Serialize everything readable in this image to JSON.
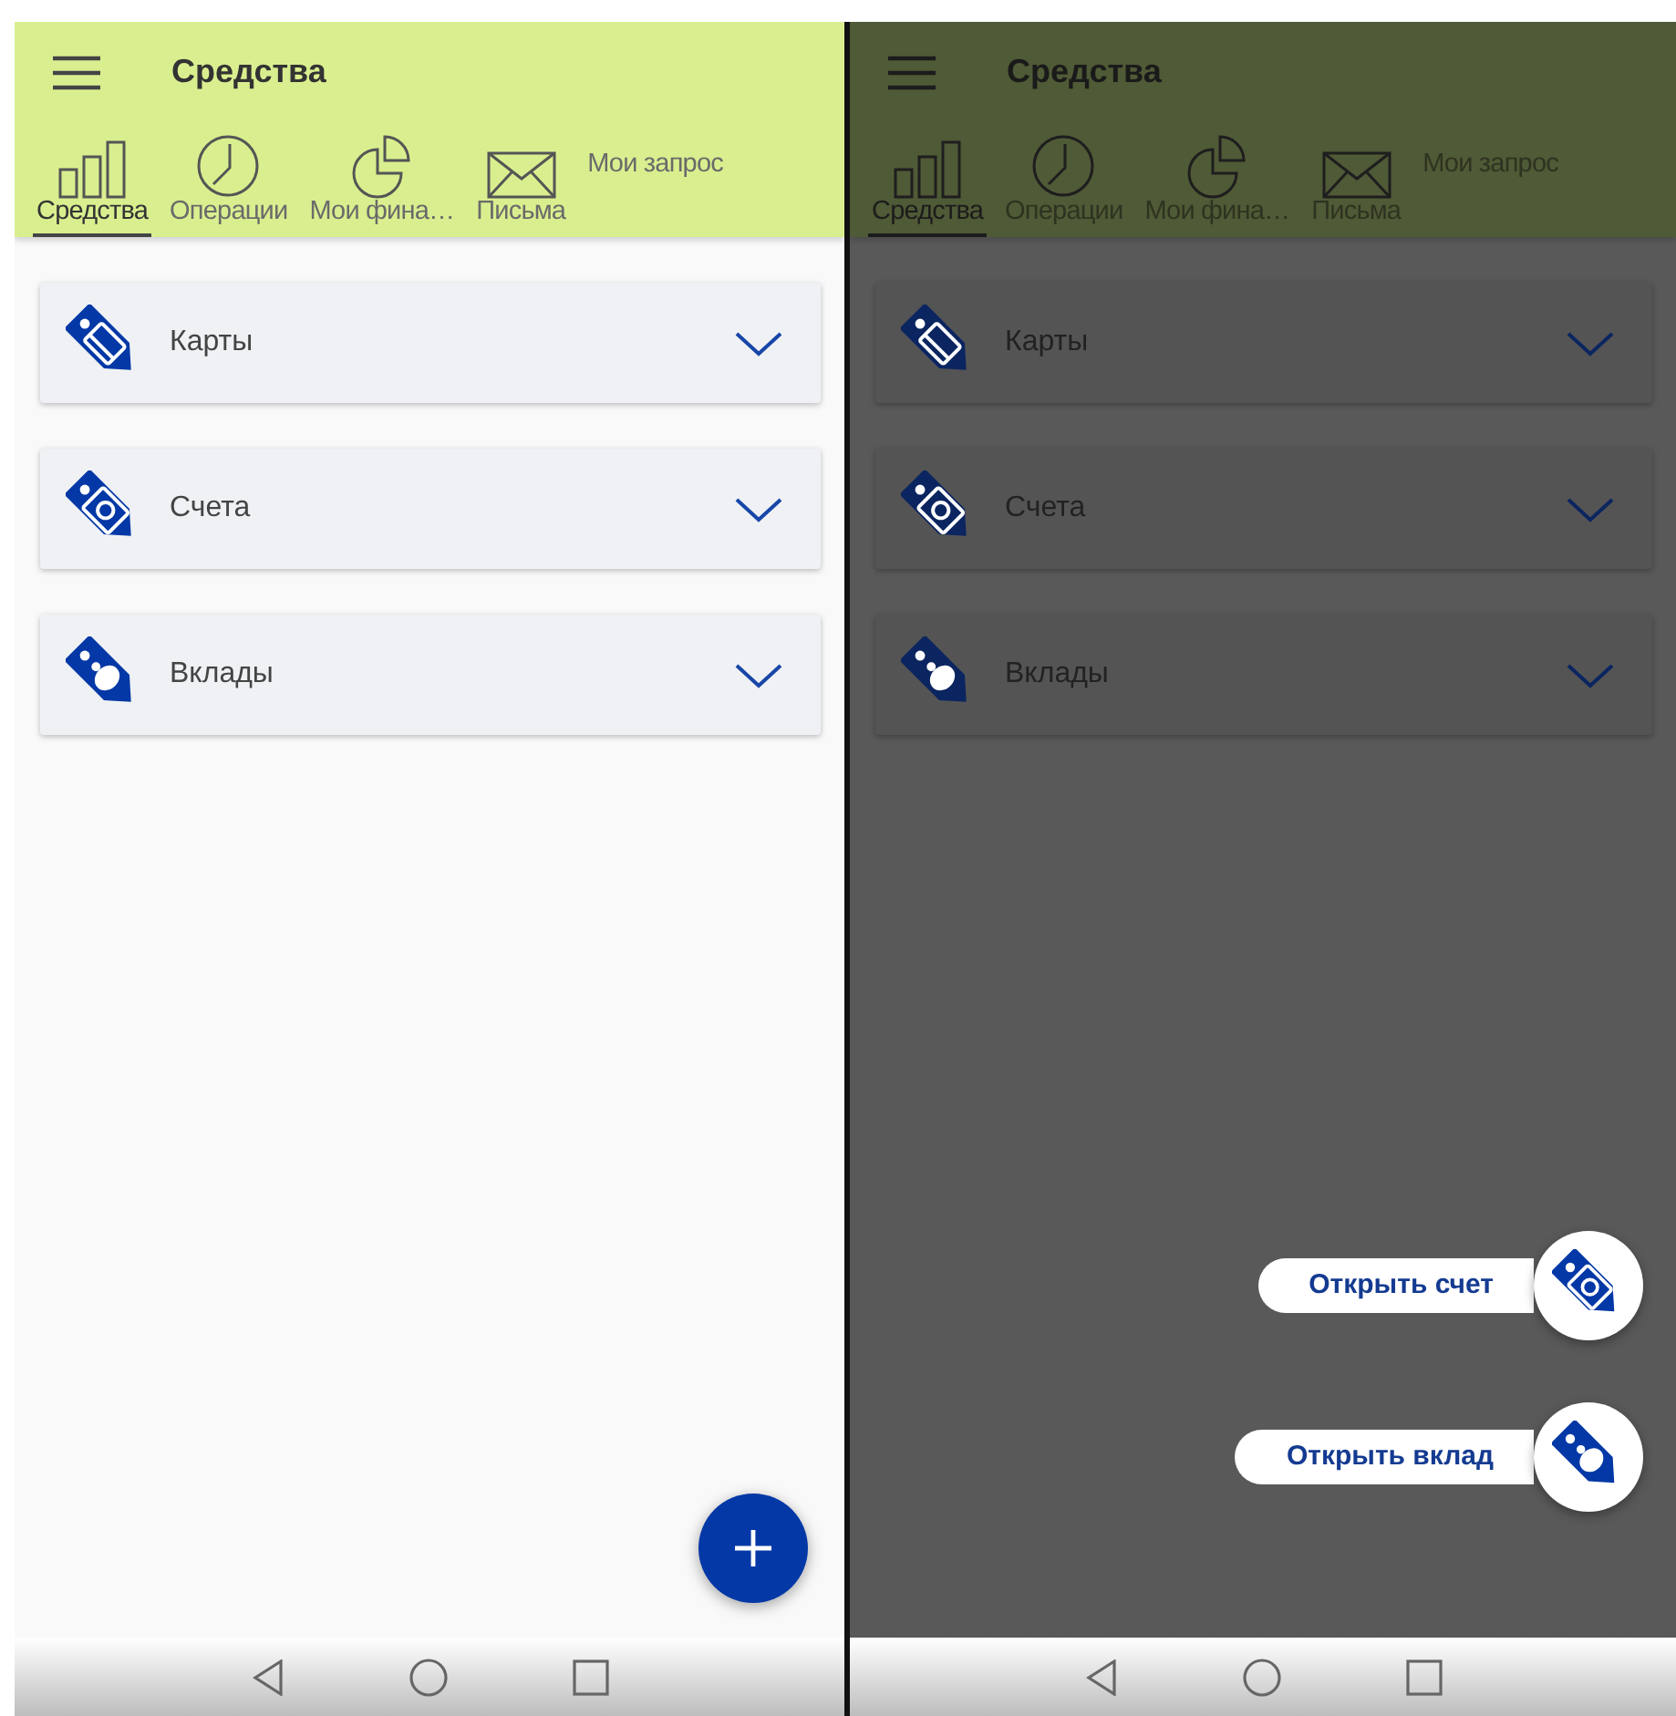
{
  "screens": [
    {
      "dimmed": false,
      "title": "Средства",
      "tabs": [
        {
          "label": "Средства",
          "kind": "bars",
          "selected": true
        },
        {
          "label": "Операции",
          "kind": "clock",
          "selected": false
        },
        {
          "label": "Мои фина…",
          "kind": "pie",
          "selected": false
        },
        {
          "label": "Письма",
          "kind": "mail",
          "selected": false
        },
        {
          "label": "Мои запрос",
          "kind": "none",
          "selected": false
        }
      ],
      "sections": [
        {
          "label": "Карты",
          "kind": "card",
          "expanded": false
        },
        {
          "label": "Счета",
          "kind": "money",
          "expanded": false
        },
        {
          "label": "Вклады",
          "kind": "piggy",
          "expanded": false
        }
      ],
      "fab_open": false
    },
    {
      "dimmed": true,
      "title": "Средства",
      "tabs": [
        {
          "label": "Средства",
          "kind": "bars",
          "selected": true
        },
        {
          "label": "Операции",
          "kind": "clock",
          "selected": false
        },
        {
          "label": "Мои фина…",
          "kind": "pie",
          "selected": false
        },
        {
          "label": "Письма",
          "kind": "mail",
          "selected": false
        },
        {
          "label": "Мои запрос",
          "kind": "none",
          "selected": false
        }
      ],
      "sections": [
        {
          "label": "Карты",
          "kind": "card",
          "expanded": false
        },
        {
          "label": "Счета",
          "kind": "money",
          "expanded": false
        },
        {
          "label": "Вклады",
          "kind": "piggy",
          "expanded": false
        }
      ],
      "fab_open": true,
      "fab_menu": [
        {
          "label": "Открыть счет",
          "kind": "money"
        },
        {
          "label": "Открыть вклад",
          "kind": "piggy"
        }
      ]
    }
  ]
}
